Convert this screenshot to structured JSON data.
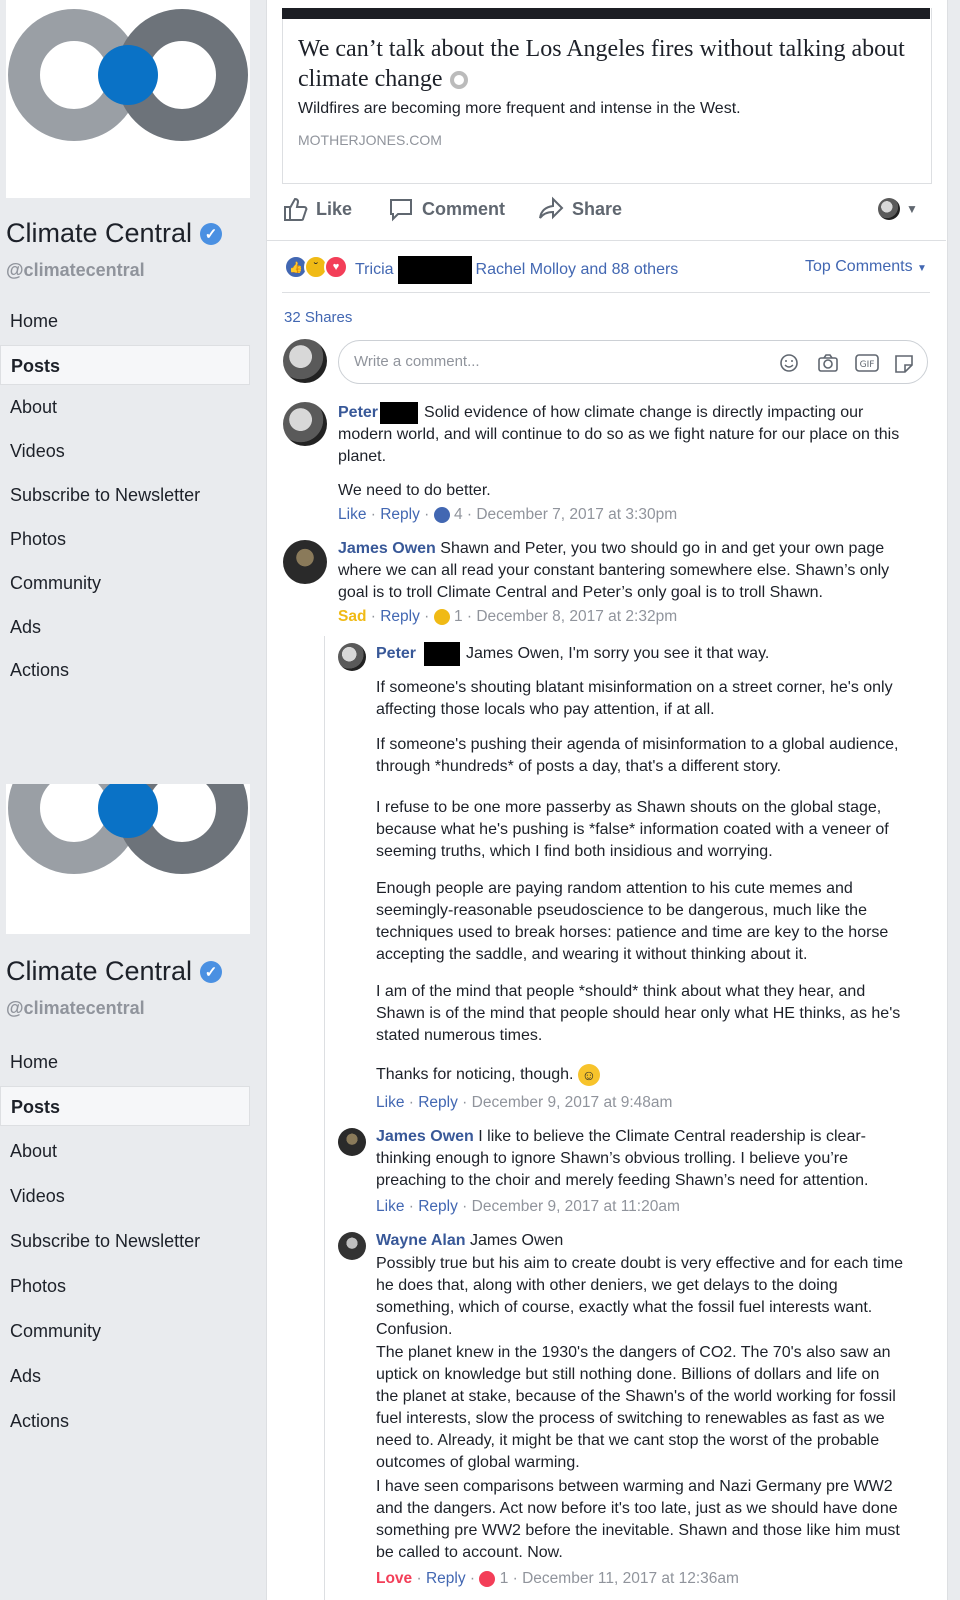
{
  "sidebar": {
    "page_name": "Climate Central",
    "handle": "@climatecentral",
    "nav": [
      "Home",
      "Posts",
      "About",
      "Videos",
      "Subscribe to Newsletter",
      "Photos",
      "Community",
      "Ads",
      "Actions"
    ],
    "active": "Posts"
  },
  "link": {
    "title": "We can’t talk about the Los Angeles fires without talking about climate change",
    "description": "Wildfires are becoming more frequent and intense in the West.",
    "domain": "MOTHERJONES.COM"
  },
  "actions": {
    "like": "Like",
    "comment": "Comment",
    "share": "Share"
  },
  "reactions": {
    "first_name": "Tricia",
    "rest": "Rachel Molloy and 88 others",
    "top_comments": "Top Comments",
    "shares": "32 Shares"
  },
  "composer": {
    "placeholder": "Write a comment..."
  },
  "comments": [
    {
      "author": "Peter",
      "paragraphs": [
        "Solid evidence of how climate change is directly impacting our modern world, and will continue to do so as we fight nature for our place on this planet.",
        "We need to do better."
      ],
      "reaction": "Like",
      "reply": "Reply",
      "count": "4",
      "date": "December 7, 2017 at 3:30pm"
    },
    {
      "author": "James Owen",
      "paragraphs": [
        "Shawn and Peter, you two should go in and get your own page where we can all read your constant bantering somewhere else. Shawn’s only goal is to troll Climate Central and Peter’s only goal is to troll Shawn."
      ],
      "reaction": "Sad",
      "reply": "Reply",
      "count": "1",
      "date": "December 8, 2017 at 2:32pm"
    }
  ],
  "replies": [
    {
      "author": "Peter",
      "paragraphs": [
        "James Owen, I'm sorry you see it that way.",
        "If someone's shouting blatant misinformation on a street corner, he's only affecting those locals who pay attention, if at all.",
        "If someone's pushing their agenda of misinformation to a global audience, through *hundreds* of posts a day, that's a different story.",
        "I refuse to be one more passerby as Shawn shouts on the global stage, because what he's pushing is *false* information coated with a veneer of seeming truths, which I find both insidious and worrying.",
        "Enough people are paying random attention to his cute memes and seemingly-reasonable pseudoscience to be dangerous, much like the techniques used to break horses: patience and time are key to the horse accepting the saddle, and wearing it without thinking about it.",
        "I am of the mind that people *should* think about what they hear, and Shawn is of the mind that people should hear only what HE thinks, as he's stated numerous times.",
        "Thanks for noticing, though."
      ],
      "reaction": "Like",
      "reply": "Reply",
      "date": "December 9, 2017 at 9:48am"
    },
    {
      "author": "James Owen",
      "paragraphs": [
        "I like to believe the Climate Central readership is clear-thinking enough to ignore Shawn’s obvious trolling. I believe you’re preaching to the choir and merely feeding Shawn’s need for attention."
      ],
      "reaction": "Like",
      "reply": "Reply",
      "date": "December 9, 2017 at 11:20am"
    },
    {
      "author": "Wayne Alan",
      "mention": "James Owen",
      "paragraphs": [
        "Possibly true but his aim to create doubt is very effective and for each time he does that, along with other deniers, we get delays to the doing something, which of course, exactly what the fossil fuel interests want. Confusion.",
        "The planet knew in the 1930's the dangers of CO2. The 70's also saw an uptick on knowledge but still nothing done. Billions of dollars and life on the planet at stake, because of the Shawn's of the world working for fossil fuel interests, slow the process of switching to renewables as fast as we need to. Already, it might be that we cant stop the worst of the probable outcomes of global warming.",
        "I have seen comparisons between warming and Nazi Germany pre WW2 and the dangers. Act now before it's too late, just as we should have done something pre WW2 before the inevitable. Shawn and those like him must be called to account. Now."
      ],
      "reaction": "Love",
      "reply": "Reply",
      "count": "1",
      "date": "December 11, 2017 at 12:36am"
    }
  ],
  "colors": {
    "fb_blue": "#4267b2",
    "name_blue": "#385898",
    "sad_yellow": "#f0ba15",
    "love_red": "#f33e58",
    "logo_blue": "#0a72c6"
  }
}
